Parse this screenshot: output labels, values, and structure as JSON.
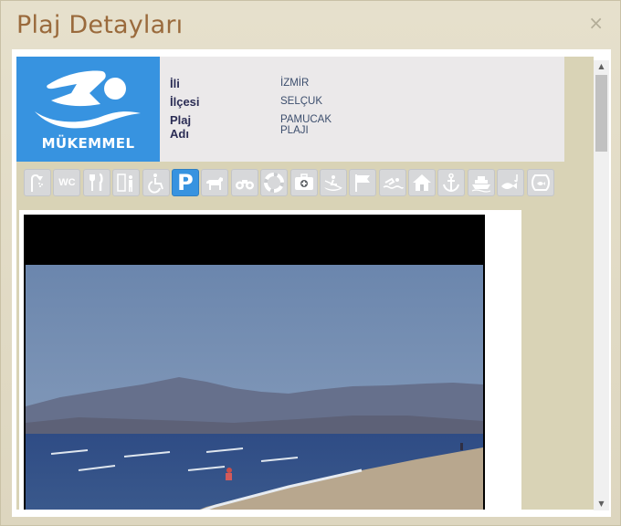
{
  "dialog": {
    "title": "Plaj Detayları",
    "close_label": "×"
  },
  "badge": {
    "label": "MÜKEMMEL",
    "color": "#3793e0"
  },
  "info": {
    "fields": [
      {
        "label": "İli",
        "value": "İZMİR"
      },
      {
        "label": "İlçesi",
        "value": "SELÇUK"
      },
      {
        "label": "Plaj Adı",
        "value": "PAMUCAK PLAJI"
      }
    ]
  },
  "facilities": [
    {
      "name": "shower-icon",
      "active": false
    },
    {
      "name": "wc-icon",
      "active": false,
      "text": "WC"
    },
    {
      "name": "restaurant-icon",
      "active": false
    },
    {
      "name": "changing-room-icon",
      "active": false
    },
    {
      "name": "wheelchair-icon",
      "active": false
    },
    {
      "name": "parking-icon",
      "active": true,
      "text": "P"
    },
    {
      "name": "dog-icon",
      "active": false
    },
    {
      "name": "binoculars-icon",
      "active": false
    },
    {
      "name": "lifebuoy-icon",
      "active": false
    },
    {
      "name": "first-aid-icon",
      "active": false
    },
    {
      "name": "rowing-icon",
      "active": false
    },
    {
      "name": "flag-icon",
      "active": false
    },
    {
      "name": "swimming-icon",
      "active": false
    },
    {
      "name": "house-icon",
      "active": false
    },
    {
      "name": "anchor-icon",
      "active": false
    },
    {
      "name": "boat-icon",
      "active": false
    },
    {
      "name": "fishing-icon",
      "active": false
    },
    {
      "name": "fishbowl-icon",
      "active": false
    }
  ],
  "colors": {
    "accent": "#3793e0",
    "title": "#9a6a3c",
    "icon_inactive": "#d7d8da"
  }
}
